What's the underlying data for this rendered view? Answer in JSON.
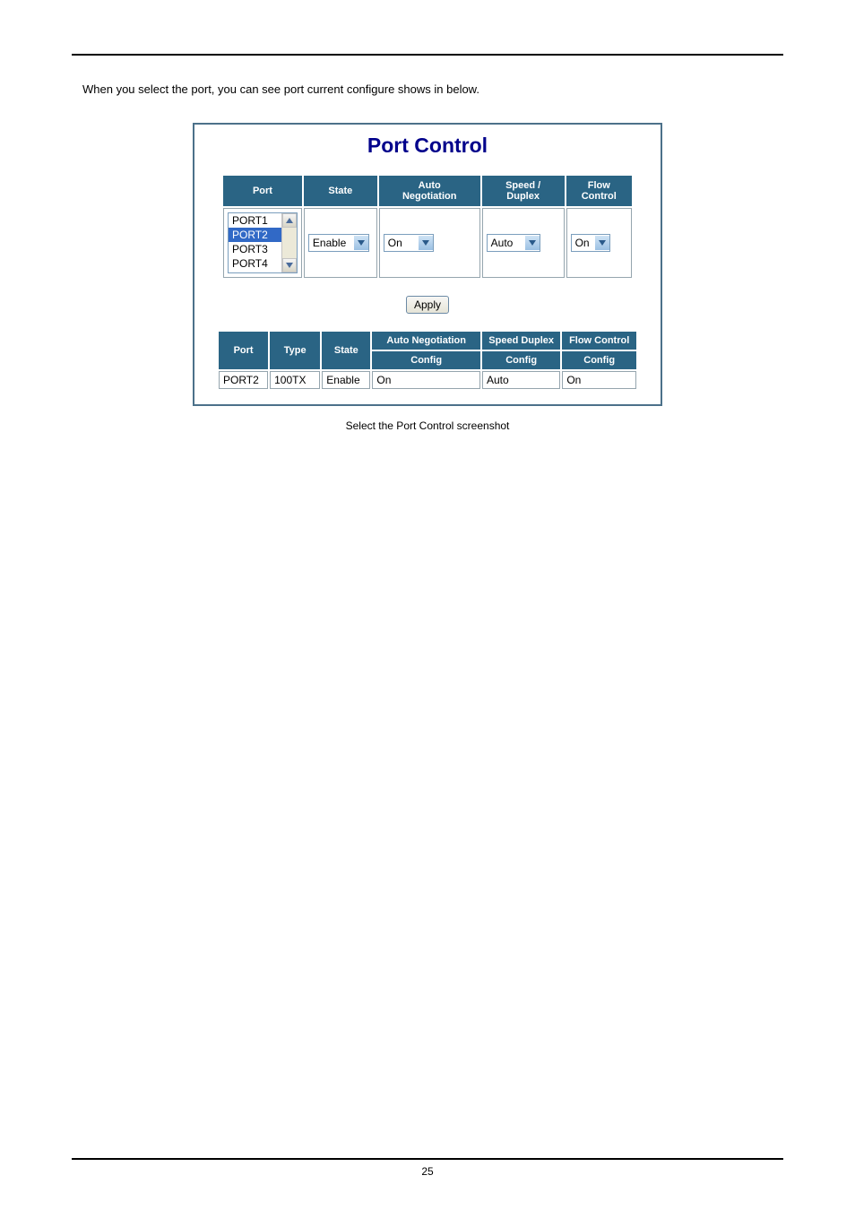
{
  "intro_text": "When you select the port, you can see port current configure shows in below.",
  "screenshot_title": "Port Control",
  "upper": {
    "headers": {
      "port": "Port",
      "state": "State",
      "autoneg_l1": "Auto",
      "autoneg_l2": "Negotiation",
      "speed_l1": "Speed /",
      "speed_l2": "Duplex",
      "flow_l1": "Flow",
      "flow_l2": "Control"
    },
    "ports": [
      "PORT1",
      "PORT2",
      "PORT3",
      "PORT4"
    ],
    "ports_selected_index": 1,
    "state_value": "Enable",
    "autoneg_value": "On",
    "speed_value": "Auto",
    "flow_value": "On"
  },
  "apply_label": "Apply",
  "lower": {
    "headers": {
      "port": "Port",
      "type": "Type",
      "state": "State",
      "autoneg": "Auto Negotiation",
      "speed": "Speed Duplex",
      "flow": "Flow Control",
      "config": "Config"
    },
    "row": {
      "port": "PORT2",
      "type": "100TX",
      "state": "Enable",
      "autoneg_config": "On",
      "speed_config": "Auto",
      "flow_config": "On"
    }
  },
  "caption": "Select the Port Control screenshot",
  "page_number": "25"
}
